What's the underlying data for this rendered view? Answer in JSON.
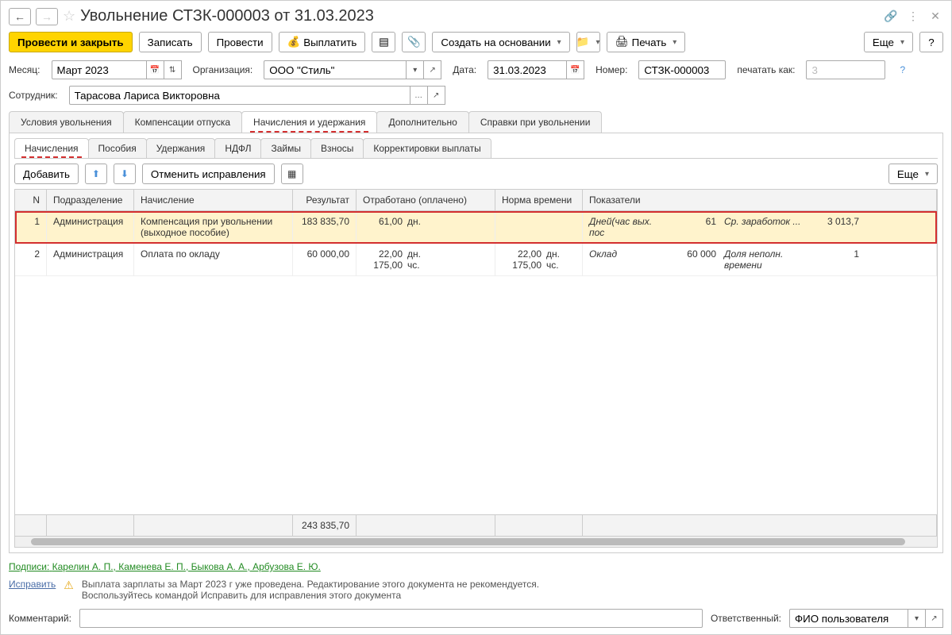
{
  "title": "Увольнение СТЗК-000003 от 31.03.2023",
  "toolbar": {
    "postClose": "Провести и закрыть",
    "save": "Записать",
    "post": "Провести",
    "pay": "Выплатить",
    "createBased": "Создать на основании",
    "print": "Печать",
    "more": "Еще"
  },
  "fields": {
    "monthLabel": "Месяц:",
    "month": "Март 2023",
    "orgLabel": "Организация:",
    "org": "ООО \"Стиль\"",
    "dateLabel": "Дата:",
    "date": "31.03.2023",
    "numLabel": "Номер:",
    "num": "СТЗК-000003",
    "printAsLabel": "печатать как:",
    "printAs": "3",
    "employeeLabel": "Сотрудник:",
    "employee": "Тарасова Лариса Викторовна"
  },
  "mainTabs": [
    "Условия увольнения",
    "Компенсации отпуска",
    "Начисления и удержания",
    "Дополнительно",
    "Справки при увольнении"
  ],
  "subTabs": [
    "Начисления",
    "Пособия",
    "Удержания",
    "НДФЛ",
    "Займы",
    "Взносы",
    "Корректировки выплаты"
  ],
  "tableToolbar": {
    "add": "Добавить",
    "cancelFix": "Отменить исправления",
    "more": "Еще"
  },
  "columns": {
    "n": "N",
    "dept": "Подразделение",
    "acc": "Начисление",
    "res": "Результат",
    "worked": "Отработано (оплачено)",
    "norm": "Норма времени",
    "ind": "Показатели"
  },
  "rows": [
    {
      "n": "1",
      "dept": "Администрация",
      "acc": "Компенсация при увольнении (выходное пособие)",
      "res": "183 835,70",
      "workedVal": "61,00",
      "workedUnit": "дн.",
      "normVal": "",
      "normUnit": "",
      "ind1Name": "Дней(час вых. пос",
      "ind1Val": "61",
      "ind2Name": "Ср. заработок ...",
      "ind2Val": "3 013,7",
      "selected": true
    },
    {
      "n": "2",
      "dept": "Администрация",
      "acc": "Оплата по окладу",
      "res": "60 000,00",
      "workedVal": "22,00",
      "workedUnit": "дн.",
      "workedVal2": "175,00",
      "workedUnit2": "чс.",
      "normVal": "22,00",
      "normUnit": "дн.",
      "normVal2": "175,00",
      "normUnit2": "чс.",
      "ind1Name": "Оклад",
      "ind1Val": "60 000",
      "ind2Name": "Доля неполн. времени",
      "ind2Val": "1"
    }
  ],
  "footerTotal": "243 835,70",
  "signatures": {
    "prefix": "Подписи:",
    "names": "Карелин А. П., Каменева Е. П., Быкова А. А., Арбузова Е. Ю."
  },
  "fixLink": "Исправить",
  "warning": "Выплата зарплаты за Март 2023 г уже проведена. Редактирование этого документа не рекомендуется. Воспользуйтесь командой Исправить для исправления этого документа",
  "commentLabel": "Комментарий:",
  "responsibleLabel": "Ответственный:",
  "responsible": "ФИО пользователя"
}
